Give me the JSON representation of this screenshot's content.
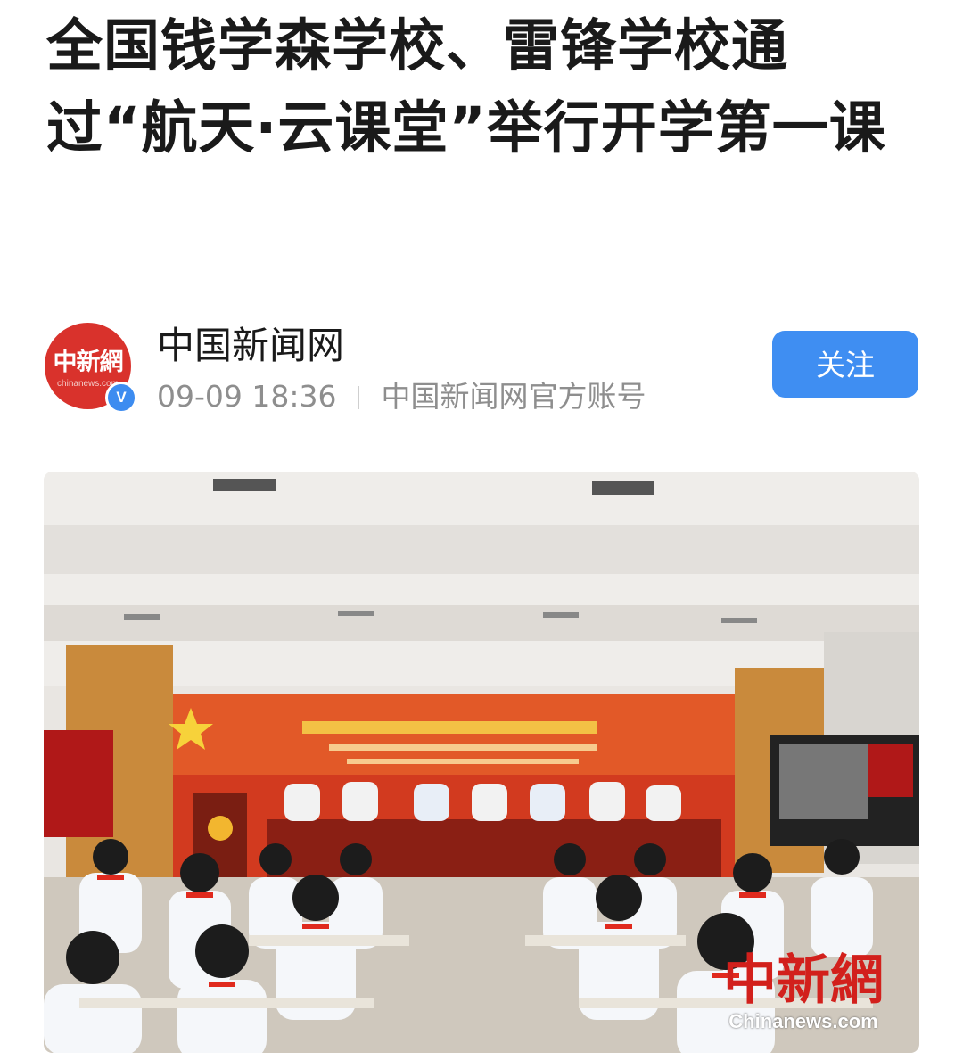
{
  "article": {
    "title": "全国钱学森学校、雷锋学校通过“航天·云课堂”举行开学第一课"
  },
  "account": {
    "name": "中国新闻网",
    "avatar_logo": "中新網",
    "avatar_sub": "chinanews.com",
    "verified_mark": "V",
    "time": "09-09 18:36",
    "description": "中国新闻网官方账号",
    "follow_label": "关注"
  },
  "photo": {
    "watermark_logo": "中新網",
    "watermark_site": "Chinanews.com"
  },
  "colors": {
    "accent": "#3f8ef2",
    "brand_red": "#d9322c",
    "text": "#1a1a1a",
    "meta": "#8e8e8e"
  }
}
